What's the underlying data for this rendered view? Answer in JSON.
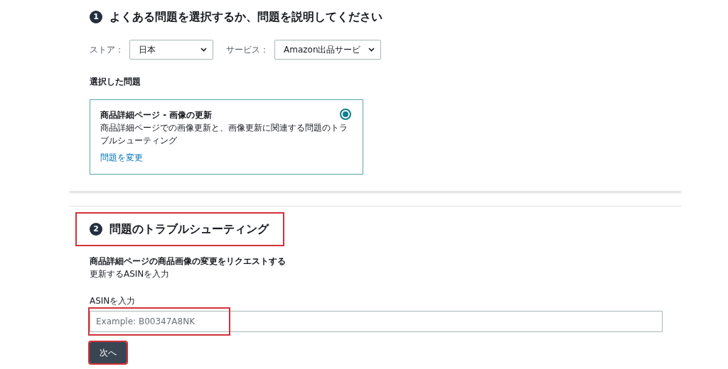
{
  "step1": {
    "number": "1",
    "title": "よくある問題を選択するか、問題を説明してください",
    "filters": [
      {
        "label": "ストア：",
        "value": "日本"
      },
      {
        "label": "サービス：",
        "value": "Amazon出品サービ"
      }
    ],
    "selected_heading": "選択した問題",
    "issue_card": {
      "title": "商品詳細ページ - 画像の更新",
      "description": "商品詳細ページでの画像更新と、画像更新に関連する問題のトラブルシューティング",
      "link": "問題を変更",
      "selected": true
    }
  },
  "step2": {
    "number": "2",
    "title": "問題のトラブルシューティング",
    "highlighted": true,
    "subtitle": "商品詳細ページの商品画像の変更をリクエストする",
    "instruction": "更新するASINを入力",
    "field": {
      "label": "ASINを入力",
      "placeholder": "Example: B00347A8NK",
      "highlighted": true
    },
    "button": {
      "label": "次へ",
      "highlighted": true
    }
  }
}
